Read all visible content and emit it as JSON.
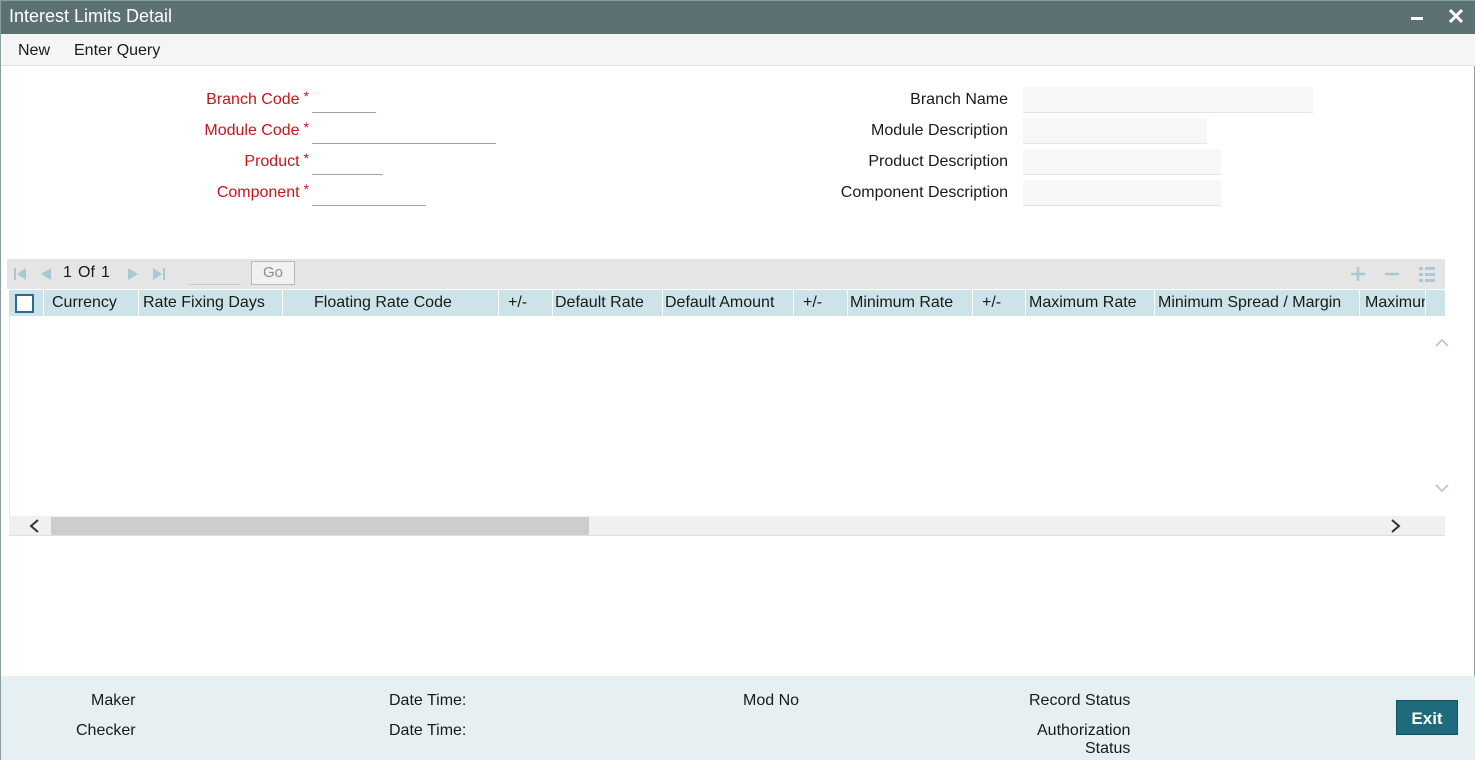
{
  "window": {
    "title": "Interest Limits Detail",
    "minimize_icon": "minimize-icon",
    "close_icon": "close-icon"
  },
  "menu": {
    "new": "New",
    "enter_query": "Enter Query"
  },
  "form": {
    "branch_code": {
      "label": "Branch Code",
      "value": ""
    },
    "module_code": {
      "label": "Module Code",
      "value": ""
    },
    "product": {
      "label": "Product",
      "value": ""
    },
    "component": {
      "label": "Component",
      "value": ""
    },
    "branch_name": {
      "label": "Branch Name",
      "value": ""
    },
    "module_description": {
      "label": "Module Description",
      "value": ""
    },
    "product_description": {
      "label": "Product Description",
      "value": ""
    },
    "component_description": {
      "label": "Component Description",
      "value": ""
    },
    "required_marker": "*"
  },
  "pager": {
    "current": "1",
    "of": "Of",
    "total": "1",
    "go": "Go"
  },
  "grid": {
    "columns": [
      "Currency",
      "Rate Fixing Days",
      "Floating Rate Code",
      "+/-",
      "Default Rate",
      "Default Amount",
      "+/-",
      "Minimum Rate",
      "+/-",
      "Maximum Rate",
      "Minimum Spread / Margin",
      "Maximum"
    ],
    "rows": []
  },
  "footer": {
    "maker": "Maker",
    "checker": "Checker",
    "date_time_1": "Date Time:",
    "date_time_2": "Date Time:",
    "mod_no": "Mod No",
    "record_status": "Record Status",
    "authorization_status_1": "Authorization",
    "authorization_status_2": "Status",
    "exit": "Exit"
  },
  "colors": {
    "titlebar": "#5c7173",
    "required_label": "#c8141b",
    "grid_header": "#cde3ea",
    "footer": "#e6f0f2",
    "exit_button": "#1d6b7c"
  }
}
